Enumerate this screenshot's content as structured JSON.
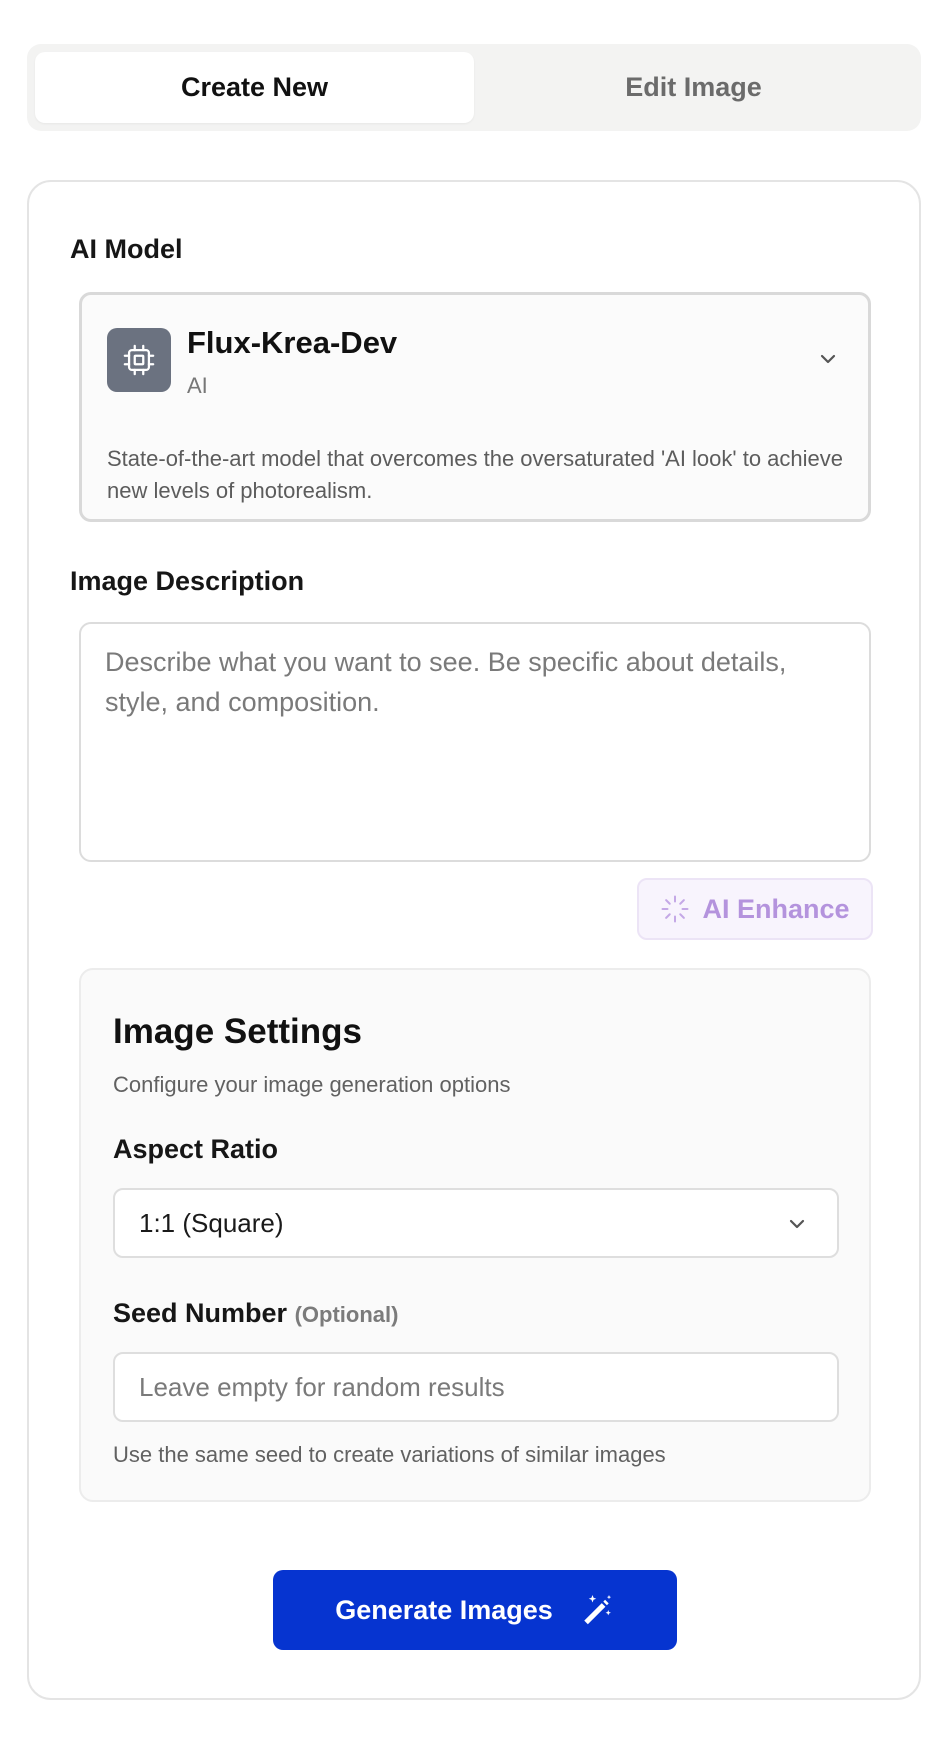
{
  "tabs": [
    {
      "label": "Create New",
      "active": true
    },
    {
      "label": "Edit Image",
      "active": false
    }
  ],
  "model": {
    "section_label": "AI Model",
    "name": "Flux-Krea-Dev",
    "provider": "AI",
    "icon": "cpu-chip-icon",
    "description": "State-of-the-art model that overcomes the oversaturated 'AI look' to achieve new levels of photorealism."
  },
  "prompt": {
    "label": "Image Description",
    "placeholder": "Describe what you want to see. Be specific about details, style, and composition.",
    "value": ""
  },
  "enhance": {
    "label": "AI Enhance",
    "icon": "spinner-icon"
  },
  "settings": {
    "title": "Image Settings",
    "subtitle": "Configure your image generation options",
    "aspect_ratio": {
      "label": "Aspect Ratio",
      "selected": "1:1 (Square)"
    },
    "seed": {
      "label": "Seed Number",
      "optional_label": "(Optional)",
      "placeholder": "Leave empty for random results",
      "value": "",
      "help": "Use the same seed to create variations of similar images"
    }
  },
  "generate": {
    "label": "Generate Images",
    "icon": "magic-wand-icon"
  },
  "colors": {
    "primary": "#0634d0",
    "enhance_text": "#b493dd",
    "enhance_bg": "#f8f4fd"
  }
}
